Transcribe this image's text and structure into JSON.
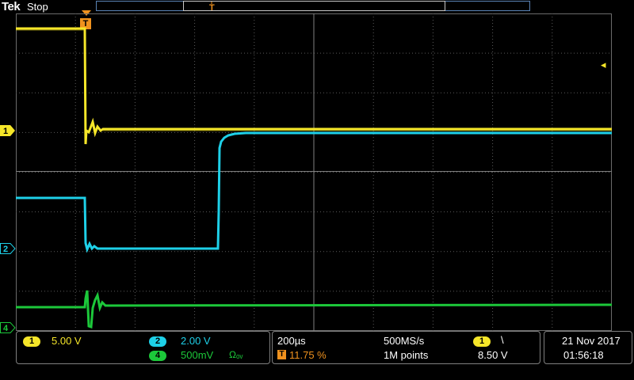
{
  "header": {
    "brand": "Tek",
    "acq_status": "Stop"
  },
  "trigger": {
    "position_marker": "T",
    "level_arrow": "◂"
  },
  "channels": {
    "ch1": {
      "number": "1",
      "scale": "5.00 V",
      "color": "#f5e629"
    },
    "ch2": {
      "number": "2",
      "scale": "2.00 V",
      "color": "#1ed0e8"
    },
    "ch4": {
      "number": "4",
      "scale": "500mV",
      "color": "#1cc83a",
      "coupling_icon": "Ωₒᵥ"
    }
  },
  "timebase": {
    "horizontal_scale": "200µs",
    "sample_rate": "500MS/s",
    "trigger_position_label": "11.75 %",
    "record_length": "1M points"
  },
  "trigger_info": {
    "source": "1",
    "slope": "\\",
    "level": "8.50 V"
  },
  "clock": {
    "date": "21 Nov 2017",
    "time": "01:56:18"
  },
  "colors": {
    "ch1": "#f5e629",
    "ch2": "#1ed0e8",
    "ch4": "#1cc83a",
    "trigger": "#f0921e",
    "graticule": "#6b6b6b",
    "record_bar": "#5a83b5"
  }
}
